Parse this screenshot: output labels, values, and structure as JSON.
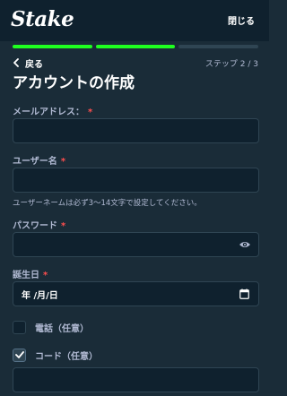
{
  "header": {
    "logo": "Stake",
    "close_label": "閉じる"
  },
  "progress": {
    "total_steps": 3,
    "completed_steps": 2
  },
  "nav": {
    "back_label": "戻る",
    "step_label": "ステップ 2 / 3"
  },
  "page": {
    "title": "アカウントの作成"
  },
  "form": {
    "email": {
      "label": "メールアドレス：",
      "required_mark": "*",
      "value": ""
    },
    "username": {
      "label": "ユーザー名",
      "required_mark": "*",
      "value": "",
      "hint": "ユーザーネームは必ず3〜14文字で設定してください。"
    },
    "password": {
      "label": "パスワード",
      "required_mark": "*",
      "value": "",
      "icon": "eye-icon"
    },
    "birthdate": {
      "label": "誕生日",
      "required_mark": "*",
      "display": "年 /月/日",
      "icon": "calendar-icon"
    },
    "phone_optional": {
      "label": "電話（任意）",
      "checked": false
    },
    "code_optional": {
      "label": "コード（任意）",
      "checked": true,
      "value": ""
    }
  },
  "colors": {
    "background": "#1a2c38",
    "header": "#0f212e",
    "accent": "#1fff20",
    "input_bg": "#0f212e",
    "required": "#ff4e4e"
  }
}
